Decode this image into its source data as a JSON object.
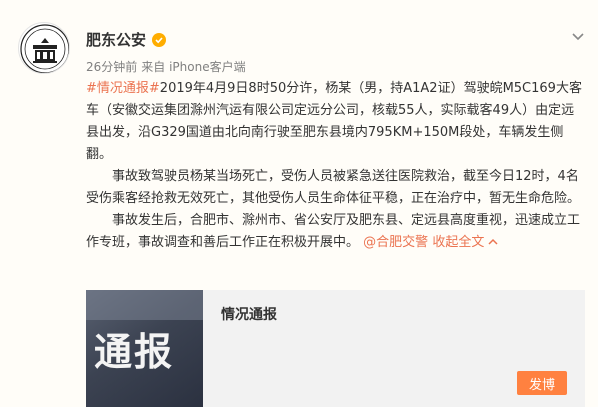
{
  "post": {
    "username": "肥东公安",
    "timestamp": "26分钟前",
    "source": "来自 iPhone客户端",
    "paragraph1": {
      "hashtag": "#情况通报#",
      "text": "2019年4月9日8时50分许，杨某（男，持A1A2证）驾驶皖M5C169大客车（安徽交运集团滁州汽运有限公司定远分公司，核载55人，实际载客49人）由定远县出发，沿G329国道由北向南行驶至肥东县境内795KM+150M段处，车辆发生侧翻。"
    },
    "paragraph2": "事故致驾驶员杨某当场死亡，受伤人员被紧急送往医院救治，截至今日12时，4名受伤乘客经抢救无效死亡，其他受伤人员生命体征平稳，正在治疗中，暂无生命危险。",
    "paragraph3": {
      "text": "事故发生后，合肥市、滁州市、省公安厅及肥东县、定远县高度重视，迅速成立工作专班，事故调查和善后工作正在积极开展中。",
      "mention": "@合肥交警",
      "expand": "收起全文"
    }
  },
  "card": {
    "thumb_text": "通报",
    "title": "情况通报",
    "button": "发博"
  },
  "icons": {
    "verified": "verified-badge-icon",
    "menu": "chevron-down-icon",
    "expand": "chevron-up-icon"
  },
  "colors": {
    "link": "#eb7350",
    "verified": "#ffad00",
    "button": "#ff8140"
  }
}
